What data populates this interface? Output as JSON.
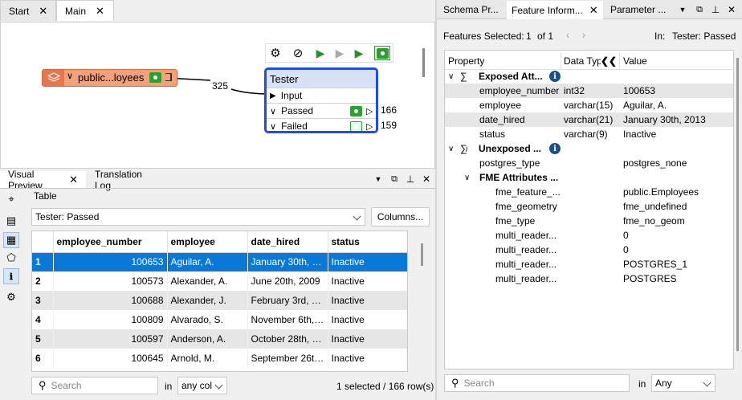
{
  "left_tabs": [
    {
      "label": "Start"
    },
    {
      "label": "Main"
    }
  ],
  "canvas": {
    "reader_label": "public...loyees",
    "connection_count": "325",
    "tester": {
      "title": "Tester",
      "input": "Input",
      "passed": "Passed",
      "passed_count": "166",
      "failed": "Failed",
      "failed_count": "159"
    }
  },
  "bottom_tabs": [
    {
      "label": "Visual Preview"
    },
    {
      "label": "Translation Log"
    }
  ],
  "preview": {
    "table_label": "Table",
    "table_select": "Tester: Passed",
    "columns_button": "Columns...",
    "columns": [
      "employee_number",
      "employee",
      "date_hired",
      "status"
    ],
    "rows": [
      {
        "n": "1",
        "employee_number": "100653",
        "employee": "Aguilar, A.",
        "date_hired": "January 30th, 2...",
        "status": "Inactive"
      },
      {
        "n": "2",
        "employee_number": "100573",
        "employee": "Alexander, A.",
        "date_hired": "June 20th, 2009",
        "status": "Inactive"
      },
      {
        "n": "3",
        "employee_number": "100688",
        "employee": "Alexander, J.",
        "date_hired": "February 3rd, 2...",
        "status": "Inactive"
      },
      {
        "n": "4",
        "employee_number": "100809",
        "employee": "Alvarado, S.",
        "date_hired": "November 6th, ...",
        "status": "Inactive"
      },
      {
        "n": "5",
        "employee_number": "100597",
        "employee": "Anderson, A.",
        "date_hired": "October 28th, 2...",
        "status": "Inactive"
      },
      {
        "n": "6",
        "employee_number": "100645",
        "employee": "Arnold, M.",
        "date_hired": "September 26th...",
        "status": "Inactive"
      }
    ],
    "search_placeholder": "Search",
    "in_label": "in",
    "col_select": "any col",
    "status_text": "1 selected / 166 row(s)"
  },
  "right_tabs": [
    {
      "label": "Schema Pr..."
    },
    {
      "label": "Feature Inform..."
    },
    {
      "label": "Parameter ..."
    }
  ],
  "feature_info": {
    "features_selected_label": "Features Selected:",
    "current": "1",
    "of_label": "of 1",
    "in_label": "In:",
    "in_value": "Tester: Passed",
    "headers": {
      "property": "Property",
      "data_type": "Data Typ",
      "value": "Value"
    },
    "exposed_group": "Exposed Att...",
    "exposed": [
      {
        "name": "employee_number",
        "type": "int32",
        "value": "100653"
      },
      {
        "name": "employee",
        "type": "varchar(15)",
        "value": "Aguilar, A."
      },
      {
        "name": "date_hired",
        "type": "varchar(21)",
        "value": "January 30th, 2013"
      },
      {
        "name": "status",
        "type": "varchar(9)",
        "value": "Inactive"
      }
    ],
    "unexposed_group": "Unexposed ...",
    "unexposed": [
      {
        "name": "postgres_type",
        "value": "postgres_none"
      }
    ],
    "fme_group": "FME Attributes ...",
    "fme": [
      {
        "name": "fme_feature_...",
        "value": "public.Employees"
      },
      {
        "name": "fme_geometry",
        "value": "fme_undefined"
      },
      {
        "name": "fme_type",
        "value": "fme_no_geom"
      },
      {
        "name": "multi_reader...",
        "value": "0"
      },
      {
        "name": "multi_reader...",
        "value": "0"
      },
      {
        "name": "multi_reader...",
        "value": "POSTGRES_1"
      },
      {
        "name": "multi_reader...",
        "value": "POSTGRES"
      }
    ],
    "search_placeholder": "Search",
    "in2_label": "in",
    "any_select": "Any"
  },
  "colors": {
    "selection": "#0a78d7",
    "tester_border": "#1f4fe0",
    "reader_fill": "#f4a07a",
    "eye_green": "#2ca02c"
  }
}
